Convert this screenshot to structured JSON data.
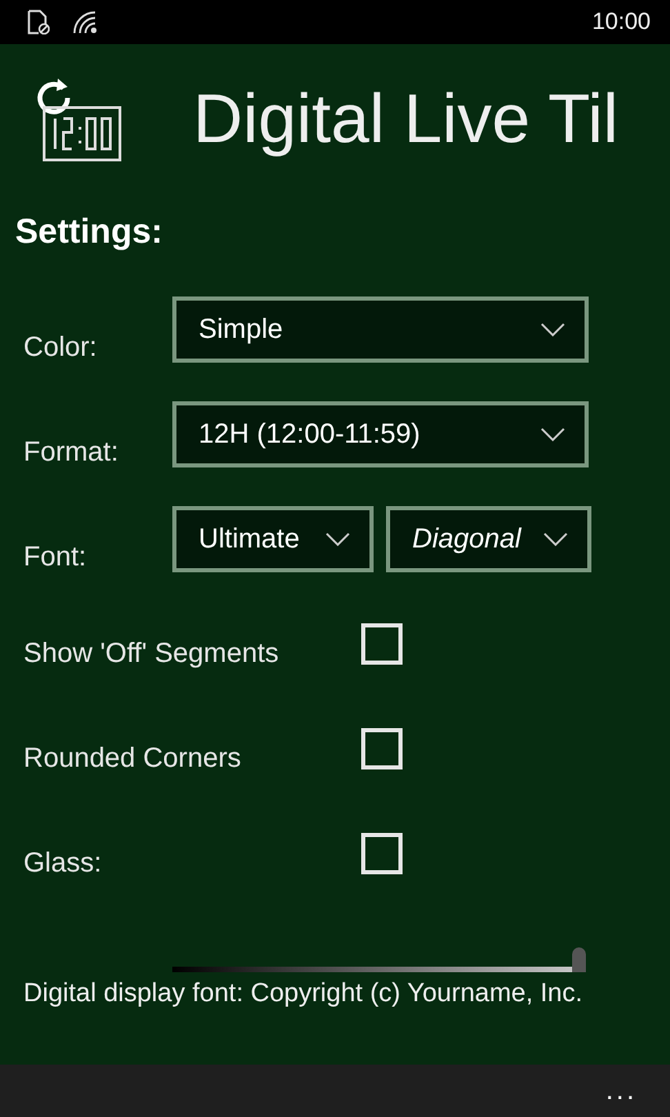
{
  "status_bar": {
    "time": "10:00"
  },
  "header": {
    "title": "Digital Live Til"
  },
  "settings": {
    "heading": "Settings:",
    "dropdowns": [
      {
        "label": "Color:",
        "values": [
          {
            "value": "Simple",
            "italic": false
          }
        ]
      },
      {
        "label": "Format:",
        "values": [
          {
            "value": "12H (12:00-11:59)",
            "italic": false
          }
        ]
      },
      {
        "label": "Font:",
        "values": [
          {
            "value": "Ultimate",
            "italic": false
          },
          {
            "value": "Diagonal",
            "italic": true
          }
        ]
      }
    ],
    "checkboxes": [
      {
        "label": "Show 'Off' Segments",
        "checked": false
      },
      {
        "label": "Rounded Corners",
        "checked": false
      },
      {
        "label": "Glass:",
        "checked": false
      }
    ],
    "slider": {
      "level": 1
    }
  },
  "footer": {
    "text": "Digital display font: Copyright (c) Yourname, Inc."
  },
  "app_bar": {
    "more": "..."
  }
}
